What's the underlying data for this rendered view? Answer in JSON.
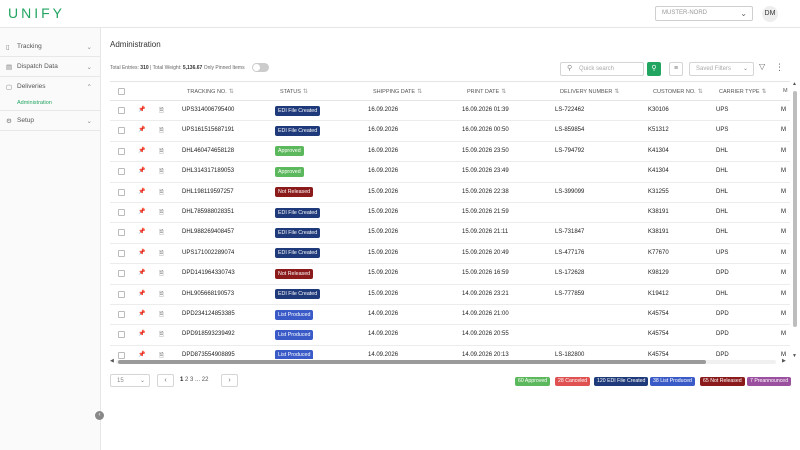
{
  "app": {
    "logo": "UNIFY"
  },
  "header": {
    "org": "MUSTER-NORD",
    "avatar": "DM"
  },
  "sidebar": {
    "items": [
      {
        "label": "Tracking",
        "icon": "truck-icon"
      },
      {
        "label": "Dispatch Data",
        "icon": "database-icon"
      },
      {
        "label": "Deliveries",
        "icon": "box-icon"
      },
      {
        "label": "Setup",
        "icon": "gear-icon"
      }
    ],
    "sub": "Administration"
  },
  "main": {
    "title": "Administration",
    "stats_entries_label": "Total Entries:",
    "stats_entries": "310",
    "stats_weight_label": "Total Weight:",
    "stats_weight": "5,136.67",
    "pinned_label": "Only Pinned Items",
    "search_placeholder": "Quick search",
    "saved_filters": "Saved Filters"
  },
  "table": {
    "columns": [
      "Tracking No.",
      "Status",
      "Shipping Date",
      "Print Date",
      "Delivery Number",
      "Customer No.",
      "Carrier Type",
      "M"
    ],
    "rows": [
      {
        "tracking": "UPS314006795400",
        "status": "EDI File Created",
        "ship": "16.09.2026",
        "print": "16.09.2026 01:39",
        "delivery": "LS-722462",
        "customer": "K30106",
        "carrier": "UPS",
        "m": "M"
      },
      {
        "tracking": "UPS161515687191",
        "status": "EDI File Created",
        "ship": "16.09.2026",
        "print": "16.09.2026 00:50",
        "delivery": "LS-859854",
        "customer": "K51312",
        "carrier": "UPS",
        "m": "M"
      },
      {
        "tracking": "DHL460474658128",
        "status": "Approved",
        "ship": "16.09.2026",
        "print": "15.09.2026 23:50",
        "delivery": "LS-794792",
        "customer": "K41304",
        "carrier": "DHL",
        "m": "M"
      },
      {
        "tracking": "DHL314317189053",
        "status": "Approved",
        "ship": "16.09.2026",
        "print": "15.09.2026 23:49",
        "delivery": "",
        "customer": "K41304",
        "carrier": "DHL",
        "m": "M"
      },
      {
        "tracking": "DHL198119597257",
        "status": "Not Released",
        "ship": "15.09.2026",
        "print": "15.09.2026 22:38",
        "delivery": "LS-399099",
        "customer": "K31255",
        "carrier": "DHL",
        "m": "M"
      },
      {
        "tracking": "DHL785988028351",
        "status": "EDI File Created",
        "ship": "15.09.2026",
        "print": "15.09.2026 21:59",
        "delivery": "",
        "customer": "K38191",
        "carrier": "DHL",
        "m": "M"
      },
      {
        "tracking": "DHL988269408457",
        "status": "EDI File Created",
        "ship": "15.09.2026",
        "print": "15.09.2026 21:11",
        "delivery": "LS-731847",
        "customer": "K38191",
        "carrier": "DHL",
        "m": "M"
      },
      {
        "tracking": "UPS171002289074",
        "status": "EDI File Created",
        "ship": "15.09.2026",
        "print": "15.09.2026 20:49",
        "delivery": "LS-477176",
        "customer": "K77670",
        "carrier": "UPS",
        "m": "M"
      },
      {
        "tracking": "DPD141964330743",
        "status": "Not Released",
        "ship": "15.09.2026",
        "print": "15.09.2026 16:59",
        "delivery": "LS-172628",
        "customer": "K98129",
        "carrier": "DPD",
        "m": "M"
      },
      {
        "tracking": "DHL905668190573",
        "status": "EDI File Created",
        "ship": "15.09.2026",
        "print": "14.09.2026 23:21",
        "delivery": "LS-777859",
        "customer": "K19412",
        "carrier": "DHL",
        "m": "M"
      },
      {
        "tracking": "DPD234124853385",
        "status": "List Produced",
        "ship": "14.09.2026",
        "print": "14.09.2026 21:00",
        "delivery": "",
        "customer": "K45754",
        "carrier": "DPD",
        "m": "M"
      },
      {
        "tracking": "DPD918593239492",
        "status": "List Produced",
        "ship": "14.09.2026",
        "print": "14.09.2026 20:55",
        "delivery": "",
        "customer": "K45754",
        "carrier": "DPD",
        "m": "M"
      },
      {
        "tracking": "DPD873554908895",
        "status": "List Produced",
        "ship": "14.09.2026",
        "print": "14.09.2026 20:13",
        "delivery": "LS-182800",
        "customer": "K45754",
        "carrier": "DPD",
        "m": "M"
      }
    ]
  },
  "status_colors": {
    "EDI File Created": "#1f3a7a",
    "Approved": "#5cb85c",
    "Not Released": "#8b1a1a",
    "List Produced": "#3a5bc7",
    "Canceled": "#e05252",
    "Preannounced": "#9b4f9f"
  },
  "pagination": {
    "page_size": "15",
    "pages": [
      "1",
      "2",
      "3",
      "...",
      "22"
    ],
    "prev": "‹",
    "next": "›"
  },
  "summary": [
    {
      "label": "60 Approved",
      "color": "#5cb85c"
    },
    {
      "label": "28 Canceled",
      "color": "#e05252"
    },
    {
      "label": "120 EDI File Created",
      "color": "#1f3a7a"
    },
    {
      "label": "38 List Produced",
      "color": "#3a5bc7"
    },
    {
      "label": "65 Not Released",
      "color": "#8b1a1a"
    },
    {
      "label": "7 Preannounced",
      "color": "#9b4f9f"
    }
  ]
}
